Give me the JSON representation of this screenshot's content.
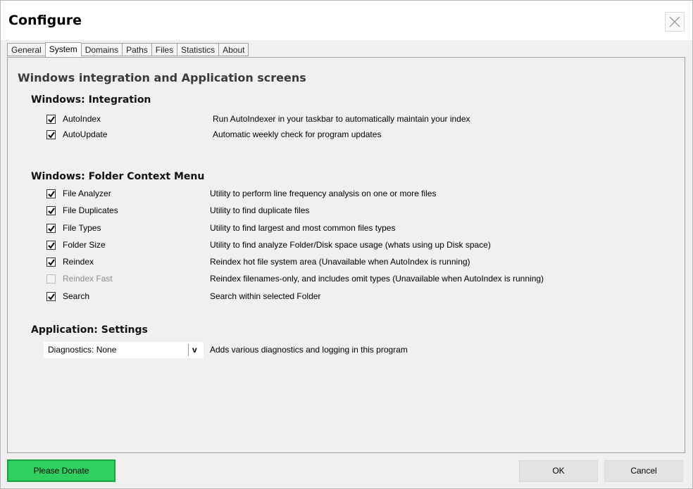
{
  "window": {
    "title": "Configure"
  },
  "tabs": [
    {
      "label": "General"
    },
    {
      "label": "System",
      "active": true
    },
    {
      "label": "Domains"
    },
    {
      "label": "Paths"
    },
    {
      "label": "Files"
    },
    {
      "label": "Statistics"
    },
    {
      "label": "About"
    }
  ],
  "panel": {
    "heading": "Windows integration and Application screens",
    "integration": {
      "heading": "Windows: Integration",
      "items": [
        {
          "label": "AutoIndex",
          "checked": true,
          "description": "Run AutoIndexer in your taskbar to automatically maintain your index"
        },
        {
          "label": "AutoUpdate",
          "checked": true,
          "description": "Automatic weekly check for program updates"
        }
      ]
    },
    "context_menu": {
      "heading": "Windows: Folder Context Menu",
      "items": [
        {
          "label": "File Analyzer",
          "checked": true,
          "description": "Utility to perform line frequency analysis on one or more files"
        },
        {
          "label": "File Duplicates",
          "checked": true,
          "description": "Utility to find duplicate files"
        },
        {
          "label": "File Types",
          "checked": true,
          "description": "Utility to find largest and most common files types"
        },
        {
          "label": "Folder Size",
          "checked": true,
          "description": "Utility to find analyze Folder/Disk space usage (whats using up Disk space)"
        },
        {
          "label": "Reindex",
          "checked": true,
          "description": "Reindex hot file system area (Unavailable when AutoIndex is running)"
        },
        {
          "label": "Reindex Fast",
          "checked": false,
          "disabled": true,
          "description": "Reindex filenames-only, and includes omit types (Unavailable when AutoIndex is running)"
        },
        {
          "label": "Search",
          "checked": true,
          "description": "Search within selected Folder"
        }
      ]
    },
    "settings": {
      "heading": "Application: Settings",
      "diagnostics": {
        "value": "Diagnostics: None",
        "arrow": "v",
        "description": "Adds various diagnostics and logging in this program"
      }
    }
  },
  "footer": {
    "donate_label": "Please Donate",
    "ok_label": "OK",
    "cancel_label": "Cancel"
  },
  "colors": {
    "donate": "#2ed15f",
    "donate_border": "#17a640",
    "background": "#f0f0f0"
  }
}
